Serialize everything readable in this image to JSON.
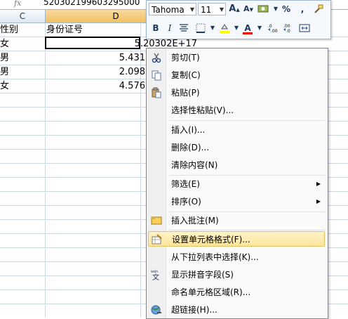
{
  "formula_bar": {
    "fx_label": "fx",
    "value": "520302199603295000"
  },
  "columns": [
    {
      "label": "C",
      "active": false
    },
    {
      "label": "D",
      "active": true
    }
  ],
  "rows": [
    {
      "c": "性别",
      "d": "身份证号"
    },
    {
      "c": "女",
      "d": "5.20302E+17"
    },
    {
      "c": "男",
      "d": "5.431"
    },
    {
      "c": "男",
      "d": "2.098"
    },
    {
      "c": "女",
      "d": "4.576"
    }
  ],
  "mini_toolbar": {
    "font_name": "Tahoma",
    "font_size": "11",
    "bold": "B",
    "italic": "I",
    "percent": "%",
    "comma": ",",
    "font_color": "A",
    "grow_font": "A",
    "shrink_font": "A"
  },
  "context_menu": {
    "items": [
      {
        "label": "剪切(T)",
        "icon": "scissors-icon"
      },
      {
        "label": "复制(C)",
        "icon": "copy-icon"
      },
      {
        "label": "粘贴(P)",
        "icon": "paste-icon"
      },
      {
        "label": "选择性粘贴(V)...",
        "icon": ""
      },
      {
        "label": "插入(I)...",
        "icon": ""
      },
      {
        "label": "删除(D)...",
        "icon": ""
      },
      {
        "label": "清除内容(N)",
        "icon": ""
      },
      {
        "label": "筛选(E)",
        "icon": "",
        "submenu": true
      },
      {
        "label": "排序(O)",
        "icon": "",
        "submenu": true
      },
      {
        "label": "插入批注(M)",
        "icon": "comment-icon"
      },
      {
        "label": "设置单元格格式(F)...",
        "icon": "format-cells-icon",
        "highlighted": true
      },
      {
        "label": "从下拉列表中选择(K)...",
        "icon": ""
      },
      {
        "label": "显示拼音字段(S)",
        "icon": "phonetic-icon"
      },
      {
        "label": "命名单元格区域(R)...",
        "icon": ""
      },
      {
        "label": "超链接(H)...",
        "icon": "hyperlink-icon"
      }
    ]
  },
  "colors": {
    "accent_highlight": "#fde59a",
    "grid_line": "#d0d7e5",
    "header_active": "#f1c15f"
  }
}
